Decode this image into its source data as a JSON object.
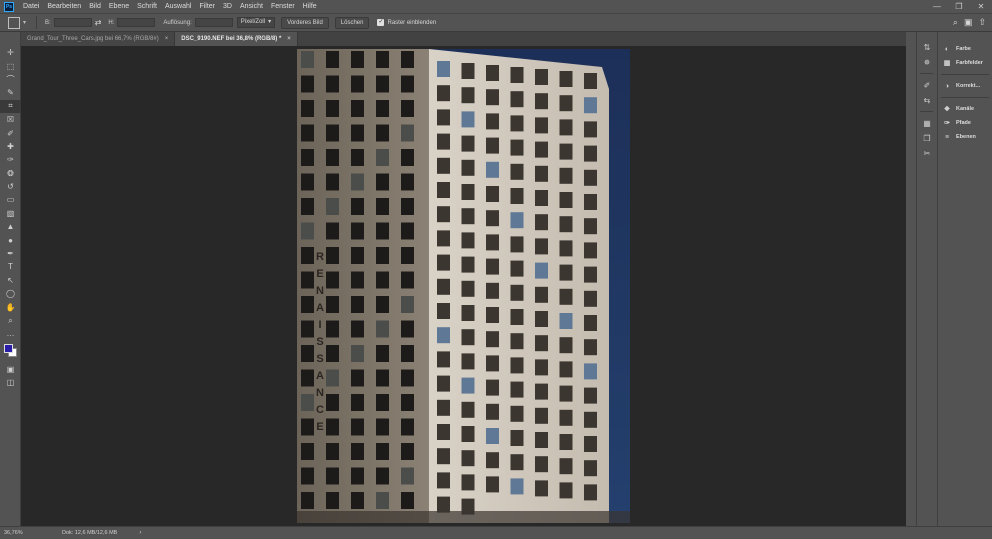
{
  "app": {
    "logo": "Ps",
    "menu": [
      "Datei",
      "Bearbeiten",
      "Bild",
      "Ebene",
      "Schrift",
      "Auswahl",
      "Filter",
      "3D",
      "Ansicht",
      "Fenster",
      "Hilfe"
    ],
    "window_controls": {
      "minimize": "—",
      "restore": "❐",
      "close": "✕"
    }
  },
  "options_bar": {
    "width_label": "B:",
    "swap_icon": "⇄",
    "height_label": "H:",
    "resolution_label": "Auflösung:",
    "unit_select": "Pixel/Zoll",
    "front_image_button": "Vorderes Bild",
    "clear_button": "Löschen",
    "show_grid_label": "Raster einblenden",
    "show_grid_checked": "✓",
    "search_icon": "⌕",
    "workspace_icon": "▣",
    "share_icon": "⇧"
  },
  "tools": [
    "move-icon",
    "marquee-icon",
    "lasso-icon",
    "quick-select-icon",
    "crop-icon",
    "frame-icon",
    "eyedropper-icon",
    "healing-icon",
    "brush-icon",
    "stamp-icon",
    "history-brush-icon",
    "eraser-icon",
    "gradient-icon",
    "blur-icon",
    "dodge-icon",
    "pen-icon",
    "type-icon",
    "path-select-icon",
    "shape-icon",
    "hand-icon",
    "zoom-icon",
    "more-tools-icon"
  ],
  "tool_glyphs": [
    "✛",
    "⬚",
    "⌒",
    "✎",
    "⌗",
    "☒",
    "✐",
    "✚",
    "✑",
    "❂",
    "↺",
    "▭",
    "▧",
    "▲",
    "●",
    "✒",
    "T",
    "↖",
    "◯",
    "✋",
    "⌕",
    "…"
  ],
  "colors": {
    "foreground": "#2a1ea8",
    "background": "#ffffff",
    "ui_bg": "#535353",
    "canvas_bg": "#282828"
  },
  "tabs": [
    {
      "label": "Grand_Tour_Three_Cars.jpg bei 66,7% (RGB/8#)",
      "close": "×",
      "active": false
    },
    {
      "label": "DSC_9190.NEF bei 36,8% (RGB/8) *",
      "close": "×",
      "active": true
    }
  ],
  "document": {
    "building_lettering": [
      "R",
      "E",
      "N",
      "A",
      "I",
      "S",
      "S",
      "A",
      "N",
      "C",
      "E"
    ]
  },
  "status": {
    "zoom": "36,76%",
    "doc_info": "Dok: 12,6 MB/12,6 MB",
    "arrow": "›"
  },
  "right_icon_strip": [
    "arrange-icon",
    "adjust-icon",
    "brush-settings-icon",
    "properties-icon",
    "library-icon",
    "notes-icon",
    "tools-icon"
  ],
  "right_icon_glyphs": [
    "⇅",
    "✵",
    "✐",
    "⇆",
    "▦",
    "❐",
    "✂"
  ],
  "panels": [
    {
      "label": "Farbe",
      "icon": "◐"
    },
    {
      "label": "Farbfelder",
      "icon": "▦"
    },
    {
      "label": "Korrekt...",
      "icon": "◑"
    },
    {
      "label": "Kanäle",
      "icon": "❖"
    },
    {
      "label": "Pfade",
      "icon": "✑"
    },
    {
      "label": "Ebenen",
      "icon": "≡"
    }
  ]
}
